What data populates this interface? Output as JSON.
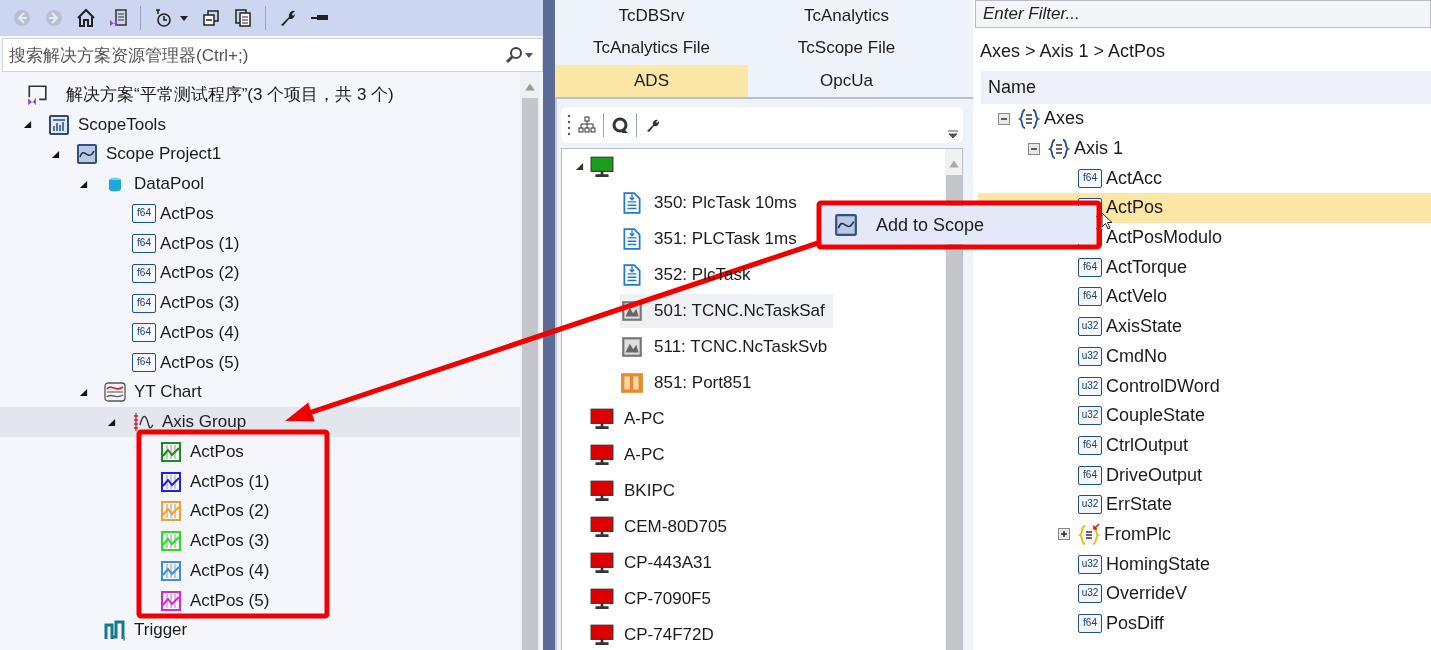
{
  "solution_explorer": {
    "search": {
      "placeholder": "搜索解决方案资源管理器(Ctrl+;)"
    },
    "solution": {
      "label": "解决方案“平常测试程序”(3 个项目，共 3 个)"
    },
    "tree": [
      {
        "label": "ScopeTools",
        "kind": "scopetools",
        "expanded": true,
        "selected": false,
        "children": [
          {
            "label": "Scope Project1",
            "kind": "scope-project",
            "expanded": true,
            "selected": false,
            "children": [
              {
                "label": "DataPool",
                "kind": "datapool",
                "expanded": true,
                "selected": false,
                "children": [
                  {
                    "label": "ActPos",
                    "kind": "badge",
                    "type": "f64",
                    "selected": false
                  },
                  {
                    "label": "ActPos (1)",
                    "kind": "badge",
                    "type": "f64",
                    "selected": false
                  },
                  {
                    "label": "ActPos (2)",
                    "kind": "badge",
                    "type": "f64",
                    "selected": false
                  },
                  {
                    "label": "ActPos (3)",
                    "kind": "badge",
                    "type": "f64",
                    "selected": false
                  },
                  {
                    "label": "ActPos (4)",
                    "kind": "badge",
                    "type": "f64",
                    "selected": false
                  },
                  {
                    "label": "ActPos (5)",
                    "kind": "badge",
                    "type": "f64",
                    "selected": false
                  }
                ]
              },
              {
                "label": "YT Chart",
                "kind": "yt-chart",
                "expanded": true,
                "selected": false,
                "children": [
                  {
                    "label": "Axis Group",
                    "kind": "axis-group",
                    "expanded": true,
                    "selected": true,
                    "children": [
                      {
                        "label": "ActPos",
                        "kind": "channel",
                        "color": "#1e8c1e",
                        "selected": false
                      },
                      {
                        "label": "ActPos (1)",
                        "kind": "channel",
                        "color": "#1f1fe6",
                        "selected": false
                      },
                      {
                        "label": "ActPos (2)",
                        "kind": "channel",
                        "color": "#f0a030",
                        "selected": false
                      },
                      {
                        "label": "ActPos (3)",
                        "kind": "channel",
                        "color": "#22e022",
                        "selected": false
                      },
                      {
                        "label": "ActPos (4)",
                        "kind": "channel",
                        "color": "#3b8ee8",
                        "selected": false
                      },
                      {
                        "label": "ActPos (5)",
                        "kind": "channel",
                        "color": "#e020e0",
                        "selected": false
                      }
                    ]
                  }
                ]
              },
              {
                "label": "Trigger",
                "kind": "trigger",
                "selected": false
              }
            ]
          }
        ]
      }
    ]
  },
  "ads_panel": {
    "tabs": [
      {
        "label": "TcDBSrv",
        "selected": false
      },
      {
        "label": "TcAnalytics",
        "selected": false
      },
      {
        "label": "TcAnalytics File",
        "selected": false
      },
      {
        "label": "TcScope File",
        "selected": false
      },
      {
        "label": "ADS",
        "selected": true
      },
      {
        "label": "OpcUa",
        "selected": false
      }
    ],
    "tree": [
      {
        "kind": "target",
        "online": true,
        "expanded": true,
        "selected": false,
        "children": [
          {
            "label": "350: PlcTask 10ms",
            "kind": "task",
            "selected": false
          },
          {
            "label": "351: PLCTask 1ms",
            "kind": "task",
            "selected": false
          },
          {
            "label": "352: PlcTask",
            "kind": "task",
            "selected": false
          },
          {
            "label": "501: TCNC.NcTaskSaf",
            "kind": "nc-task",
            "selected": true
          },
          {
            "label": "511: TCNC.NcTaskSvb",
            "kind": "nc-task",
            "selected": false
          },
          {
            "label": "851: Port851",
            "kind": "port",
            "selected": false
          }
        ]
      },
      {
        "label": "A-PC",
        "kind": "target",
        "online": false,
        "selected": false
      },
      {
        "label": "A-PC",
        "kind": "target",
        "online": false,
        "selected": false
      },
      {
        "label": "BKIPC",
        "kind": "target",
        "online": false,
        "selected": false
      },
      {
        "label": "CEM-80D705",
        "kind": "target",
        "online": false,
        "selected": false
      },
      {
        "label": "CP-443A31",
        "kind": "target",
        "online": false,
        "selected": false
      },
      {
        "label": "CP-7090F5",
        "kind": "target",
        "online": false,
        "selected": false
      },
      {
        "label": "CP-74F72D",
        "kind": "target",
        "online": false,
        "selected": false
      }
    ]
  },
  "context_menu": {
    "items": [
      {
        "label": "Add to Scope",
        "selected": true
      }
    ]
  },
  "symbol_browser": {
    "filter": {
      "placeholder": "Enter Filter..."
    },
    "breadcrumb": "Axes > Axis 1 > ActPos",
    "column": "Name",
    "tree": [
      {
        "label": "Axes",
        "kind": "struct",
        "expanded": true,
        "selected": false,
        "children": [
          {
            "label": "Axis 1",
            "kind": "struct",
            "expanded": true,
            "selected": false,
            "children": [
              {
                "label": "ActAcc",
                "kind": "badge",
                "type": "f64",
                "selected": false
              },
              {
                "label": "ActPos",
                "kind": "badge",
                "selected": true
              },
              {
                "label": "ActPosModulo",
                "kind": "badge",
                "selected": false
              },
              {
                "label": "ActTorque",
                "kind": "badge",
                "type": "f64",
                "selected": false
              },
              {
                "label": "ActVelo",
                "kind": "badge",
                "type": "f64",
                "selected": false
              },
              {
                "label": "AxisState",
                "kind": "badge",
                "type": "u32",
                "selected": false
              },
              {
                "label": "CmdNo",
                "kind": "badge",
                "type": "u32",
                "selected": false
              },
              {
                "label": "ControlDWord",
                "kind": "badge",
                "type": "u32",
                "selected": false
              },
              {
                "label": "CoupleState",
                "kind": "badge",
                "type": "u32",
                "selected": false
              },
              {
                "label": "CtrlOutput",
                "kind": "badge",
                "type": "f64",
                "selected": false
              },
              {
                "label": "DriveOutput",
                "kind": "badge",
                "type": "f64",
                "selected": false
              },
              {
                "label": "ErrState",
                "kind": "badge",
                "type": "u32",
                "selected": false
              },
              {
                "label": "FromPlc",
                "kind": "struct-link",
                "expanded": false,
                "selected": false
              },
              {
                "label": "HomingState",
                "kind": "badge",
                "type": "u32",
                "selected": false
              },
              {
                "label": "OverrideV",
                "kind": "badge",
                "type": "u32",
                "selected": false
              },
              {
                "label": "PosDiff",
                "kind": "badge",
                "type": "f64",
                "selected": false
              }
            ]
          }
        ]
      }
    ]
  }
}
